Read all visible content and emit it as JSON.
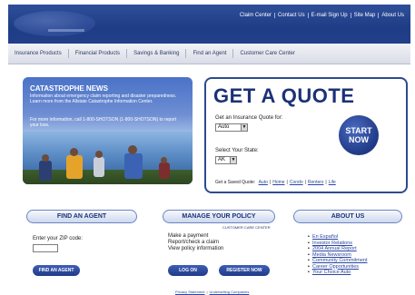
{
  "header": {
    "top_links": [
      "Claim Center",
      "Contact Us",
      "E-mail Sign Up",
      "Site Map",
      "About Us"
    ]
  },
  "nav": {
    "items": [
      "Insurance Products",
      "Financial Products",
      "Savings & Banking",
      "Find an Agent",
      "Customer Care Center"
    ]
  },
  "catastrophe": {
    "title": "CATASTROPHE NEWS",
    "body1": "Information about emergency claim reporting and disaster preparedness. Learn more from the Allstate Catastrophe Information Center.",
    "body2": "For more information, call 1-800-SHOTSON (1-800-SHOTSON) to report your loss."
  },
  "quote": {
    "title": "GET A QUOTE",
    "label_type": "Get an Insurance Quote for:",
    "type_value": "Auto",
    "label_state": "Select Your State:",
    "state_value": "AK",
    "start_line1": "START",
    "start_line2": "NOW",
    "saved_label": "Get a Saved Quote:",
    "saved_links": [
      "Auto",
      "Home",
      "Condo",
      "Renters",
      "Life"
    ]
  },
  "find_agent": {
    "header": "FIND AN AGENT",
    "zip_label": "Enter your ZIP code:",
    "button": "FIND AN AGENT"
  },
  "manage_policy": {
    "header": "MANAGE YOUR POLICY",
    "subtag": "CUSTOMER CARE CENTER",
    "line1": "Make a payment",
    "line2": "Report/check a claim",
    "line3": "View policy information",
    "login_btn": "LOG ON",
    "register_btn": "REGISTER NOW"
  },
  "about_us": {
    "header": "ABOUT US",
    "links": [
      "En Español",
      "Investor Relations",
      "2004 Annual Report",
      "Media Newsroom",
      "Community Commitment",
      "Career Opportunities",
      "Your Choice Auto"
    ]
  },
  "footer": {
    "links": [
      "Privacy Statement",
      "Underwriting Companies"
    ]
  }
}
